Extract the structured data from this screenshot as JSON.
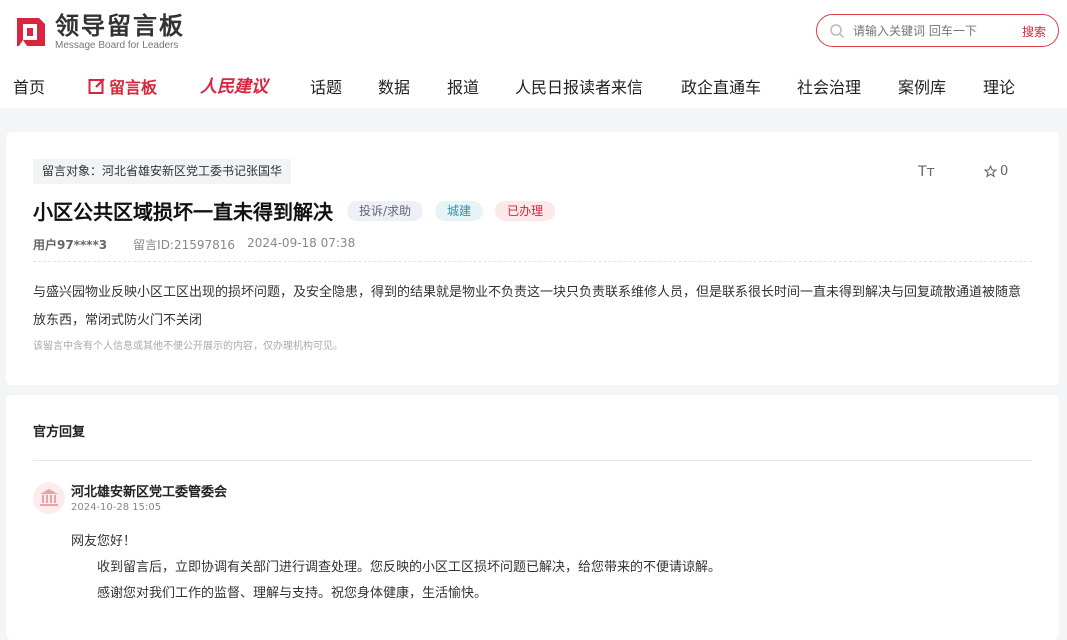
{
  "header": {
    "logo_title": "领导留言板",
    "logo_sub": "Message Board for Leaders",
    "search_placeholder": "请输入关键词 回车一下",
    "search_button": "搜索"
  },
  "nav": {
    "items": [
      "首页",
      "留言板",
      "人民建议",
      "话题",
      "数据",
      "报道",
      "人民日报读者来信",
      "政企直通车",
      "社会治理",
      "案例库",
      "理论"
    ]
  },
  "message": {
    "target": "留言对象：河北省雄安新区党工委书记张国华",
    "title": "小区公共区域损坏一直未得到解决",
    "tags": [
      "投诉/求助",
      "城建",
      "已办理"
    ],
    "font_tool": "Tт",
    "star_count": "0",
    "user": "用户97****3",
    "msg_id": "留言ID:21597816",
    "datetime": "2024-09-18 07:38",
    "content": "与盛兴园物业反映小区工区出现的损坏问题，及安全隐患，得到的结果就是物业不负责这一块只负责联系维修人员，但是联系很长时间一直未得到解决与回复疏散通道被随意放东西，常闭式防火门不关闭",
    "hint": "该留言中含有个人信息或其他不便公开展示的内容，仅办理机构可见。"
  },
  "reply": {
    "heading": "官方回复",
    "org": "河北雄安新区党工委管委会",
    "date": "2024-10-28 15:05",
    "greeting": "网友您好！",
    "line1": "收到留言后，立即协调有关部门进行调查处理。您反映的小区工区损坏问题已解决，给您带来的不便请谅解。",
    "line2": "感谢您对我们工作的监督、理解与支持。祝您身体健康，生活愉快。"
  },
  "colors": {
    "brand_red": "#d7263d",
    "bg": "#f4f5f7"
  },
  "icons": [
    "logo-icon",
    "search-icon",
    "edit-icon",
    "font-size-icon",
    "star-icon",
    "government-building-icon"
  ]
}
